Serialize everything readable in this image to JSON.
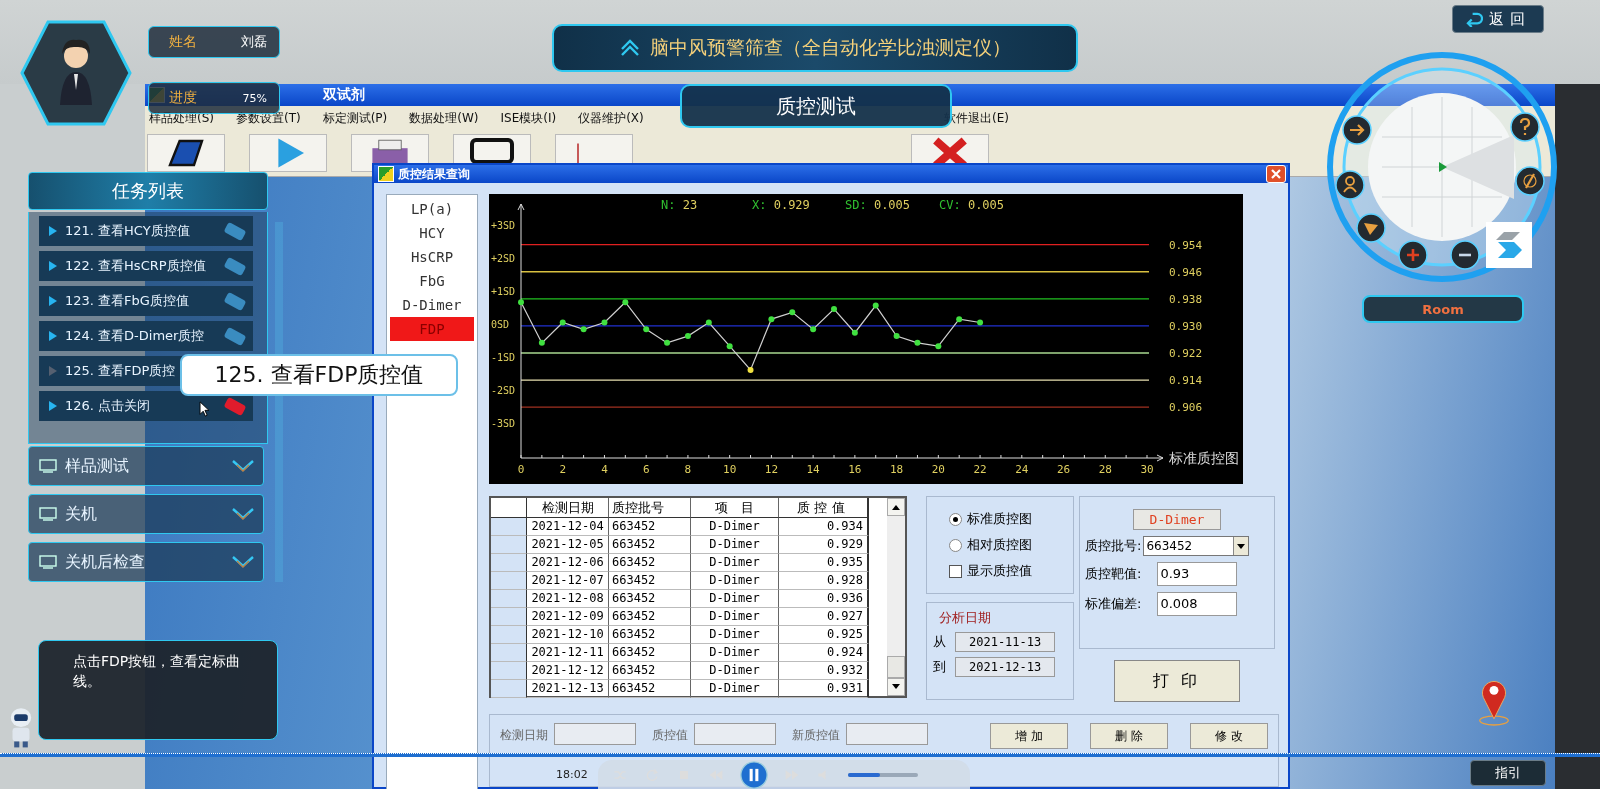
{
  "player": {
    "name_label": "姓名",
    "name": "刘磊",
    "progress_label": "进度",
    "progress": "75%"
  },
  "banner": {
    "title": "脑中风预警筛查（全自动化学比浊测定仪）",
    "mode_tab": "质控测试"
  },
  "back_button": "返回",
  "app_window": {
    "title": "双试剂",
    "menu": [
      "样品处理(S)",
      "参数设置(T)",
      "标定测试(P)",
      "数据处理(W)",
      "ISE模块(I)",
      "仪器维护(X)"
    ],
    "menu_right": [
      "软件退出(E)"
    ]
  },
  "task_list": {
    "title": "任务列表",
    "items": [
      {
        "label": "121. 查看HCY质控值",
        "done": true,
        "current": false
      },
      {
        "label": "122. 查看HsCRP质控值",
        "done": true,
        "current": false
      },
      {
        "label": "123. 查看FbG质控值",
        "done": true,
        "current": false
      },
      {
        "label": "124. 查看D-Dimer质控",
        "done": true,
        "current": false
      },
      {
        "label": "125. 查看FDP质控",
        "done": false,
        "current": true
      },
      {
        "label": "126. 点击关闭",
        "done": false,
        "current": false
      }
    ],
    "sections": [
      "样品测试",
      "关机",
      "关机后检查"
    ]
  },
  "tooltip": "125. 查看FDP质控值",
  "hint": "点击FDP按钮，查看定标曲线。",
  "minimap": {
    "label": "Room"
  },
  "guide_button": "指引",
  "dialog": {
    "title": "质控结果查询",
    "items": [
      {
        "label": "LP(a)",
        "selected": false
      },
      {
        "label": "HCY",
        "selected": false
      },
      {
        "label": "HsCRP",
        "selected": false
      },
      {
        "label": "FbG",
        "selected": false
      },
      {
        "label": "D-Dimer",
        "selected": false
      },
      {
        "label": "FDP",
        "selected": true
      }
    ],
    "chart": {
      "stats": [
        {
          "label": "N:",
          "value": "23"
        },
        {
          "label": "X:",
          "value": "0.929"
        },
        {
          "label": "SD:",
          "value": "0.005"
        },
        {
          "label": "CV:",
          "value": "0.005"
        }
      ],
      "sd_labels": [
        "+3SD",
        "+2SD",
        "+1SD",
        "0SD",
        "-1SD",
        "-2SD",
        "-3SD"
      ],
      "chart_data": {
        "type": "line",
        "xlabel": "标准质控图",
        "x": [
          0,
          1,
          2,
          3,
          4,
          5,
          6,
          7,
          8,
          9,
          10,
          11,
          12,
          13,
          14,
          15,
          16,
          17,
          18,
          19,
          20,
          21,
          22
        ],
        "series": [
          {
            "color": "#d0d0d0",
            "marker": "o",
            "values": [
              0.937,
              0.925,
              0.931,
              0.929,
              0.931,
              0.937,
              0.929,
              0.925,
              0.927,
              0.931,
              0.924,
              0.917,
              0.932,
              0.934,
              0.929,
              0.935,
              0.928,
              0.936,
              0.927,
              0.925,
              0.924,
              0.932,
              0.931
            ]
          }
        ],
        "xlim": [
          0,
          30
        ],
        "ylim": [
          0.891,
          0.966
        ],
        "xticks": [
          0,
          2,
          4,
          6,
          8,
          10,
          12,
          14,
          16,
          18,
          20,
          22,
          24,
          26,
          28,
          30
        ],
        "yticks": [
          {
            "value": 0.954,
            "label": "0.954"
          },
          {
            "value": 0.946,
            "label": "0.946"
          },
          {
            "value": 0.938,
            "label": "0.938"
          },
          {
            "value": 0.93,
            "label": "0.930"
          },
          {
            "value": 0.922,
            "label": "0.922"
          },
          {
            "value": 0.914,
            "label": "0.914"
          },
          {
            "value": 0.906,
            "label": "0.906"
          }
        ],
        "ref_lines": [
          {
            "axis": "y",
            "value": 0.954,
            "color": "#e02020"
          },
          {
            "axis": "y",
            "value": 0.946,
            "color": "#d8c040"
          },
          {
            "axis": "y",
            "value": 0.938,
            "color": "#20c020"
          },
          {
            "axis": "y",
            "value": 0.93,
            "color": "#2030d0"
          },
          {
            "axis": "y",
            "value": 0.922,
            "color": "#a8d890"
          },
          {
            "axis": "y",
            "value": 0.914,
            "color": "#e8e0b0"
          },
          {
            "axis": "y",
            "value": 0.906,
            "color": "#a03020"
          }
        ]
      }
    },
    "table": {
      "columns": [
        "检测日期",
        "质控批号",
        "项　目",
        "质 控 值"
      ],
      "rows": [
        [
          "2021-12-04",
          "663452",
          "D-Dimer",
          "0.934"
        ],
        [
          "2021-12-05",
          "663452",
          "D-Dimer",
          "0.929"
        ],
        [
          "2021-12-06",
          "663452",
          "D-Dimer",
          "0.935"
        ],
        [
          "2021-12-07",
          "663452",
          "D-Dimer",
          "0.928"
        ],
        [
          "2021-12-08",
          "663452",
          "D-Dimer",
          "0.936"
        ],
        [
          "2021-12-09",
          "663452",
          "D-Dimer",
          "0.927"
        ],
        [
          "2021-12-10",
          "663452",
          "D-Dimer",
          "0.925"
        ],
        [
          "2021-12-11",
          "663452",
          "D-Dimer",
          "0.924"
        ],
        [
          "2021-12-12",
          "663452",
          "D-Dimer",
          "0.932"
        ],
        [
          "2021-12-13",
          "663452",
          "D-Dimer",
          "0.931"
        ]
      ]
    },
    "chart_types": [
      {
        "label": "标准质控图",
        "selected": true
      },
      {
        "label": "相对质控图",
        "selected": false
      }
    ],
    "show_values": {
      "label": "显示质控值",
      "checked": false
    },
    "analysis_dates": {
      "title": "分析日期",
      "from_label": "从",
      "from": "2021-11-13",
      "to_label": "到",
      "to": "2021-12-13"
    },
    "control": {
      "item": "D-Dimer",
      "fields": [
        {
          "label": "质控批号:",
          "value": "663452",
          "kind": "dropdown"
        },
        {
          "label": "质控靶值:",
          "value": "0.93",
          "kind": "text"
        },
        {
          "label": "标准偏差:",
          "value": "0.008",
          "kind": "text"
        }
      ]
    },
    "print_button": "打 印",
    "edit_row": {
      "fields": [
        "检测日期",
        "质控值",
        "新质控值"
      ],
      "buttons": [
        "增 加",
        "删 除",
        "修 改"
      ]
    }
  },
  "video_player": {
    "time": "18:02",
    "volume": {
      "level": 0.45
    }
  }
}
